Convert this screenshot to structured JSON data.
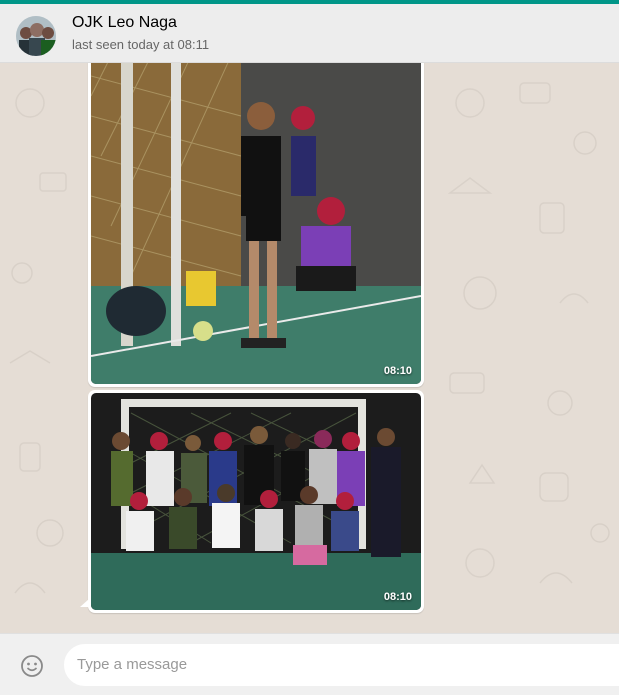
{
  "header": {
    "title": "OJK Leo Naga",
    "status": "last seen today at 08:11"
  },
  "messages": [
    {
      "type": "image",
      "direction": "incoming",
      "time": "08:10",
      "scene": "futsal-court-standing"
    },
    {
      "type": "image",
      "direction": "incoming",
      "time": "08:10",
      "scene": "futsal-team-group-photo"
    }
  ],
  "composer": {
    "placeholder": "Type a message",
    "value": "",
    "emoji_icon": "smiley-icon"
  },
  "colors": {
    "accent": "#009688",
    "header_bg": "#ededed",
    "chat_bg": "#e5ddd5",
    "composer_bg": "#f0f0f0",
    "bubble_bg": "#ffffff"
  }
}
